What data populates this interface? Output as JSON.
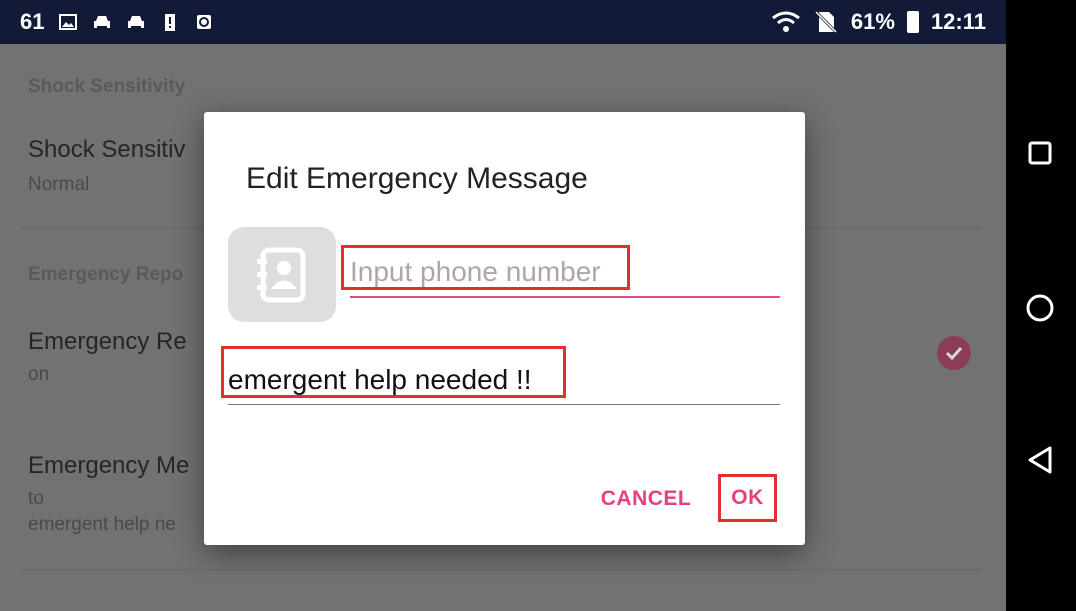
{
  "status_bar": {
    "notification_count": "61",
    "battery_percent": "61%",
    "time": "12:11",
    "icons": [
      "image-icon",
      "car-icon",
      "car-icon",
      "battery-alert-icon",
      "recycle-icon",
      "wifi-icon",
      "no-sim-icon",
      "battery-icon"
    ]
  },
  "settings": {
    "section_shock": "Shock Sensitivity",
    "shock_title": "Shock Sensitiv",
    "shock_summary": "Normal",
    "section_emergency": "Emergency Repo",
    "emergency_report_title": "Emergency Re",
    "emergency_report_summary": "on",
    "emergency_message_title": "Emergency Me",
    "emergency_message_summary_line1": "to",
    "emergency_message_summary_line2": "emergent help ne"
  },
  "dialog": {
    "title": "Edit Emergency Message",
    "phone_placeholder": "Input phone number",
    "phone_value": "",
    "message_value": "emergent help needed !!",
    "cancel_label": "CANCEL",
    "ok_label": "OK"
  },
  "colors": {
    "accent": "#e6407e",
    "highlight": "#e03030",
    "status_bar": "#121a38"
  }
}
